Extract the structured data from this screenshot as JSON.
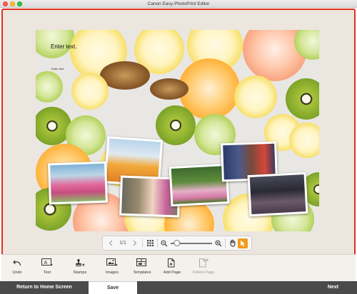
{
  "window": {
    "title": "Canon Easy-PhotoPrint Editor"
  },
  "canvas": {
    "text_placeholder_large": "Enter text.",
    "text_placeholder_small": "Enter text."
  },
  "canvas_toolbar": {
    "page_indicator": "1/1",
    "zoom_level_fraction": 0.08
  },
  "functions": {
    "undo": "Undo",
    "text": "Text",
    "stamps": "Stamps",
    "images": "Images",
    "templates": "Templates",
    "add_page": "Add Page",
    "delete_page": "Delete Page"
  },
  "bottom": {
    "return_home": "Return to Home Screen",
    "save": "Save",
    "next": "Next"
  },
  "colors": {
    "accent_border": "#e0301e",
    "cursor_tool": "#f29b1c",
    "bottom_bar": "#4a4a4a"
  }
}
